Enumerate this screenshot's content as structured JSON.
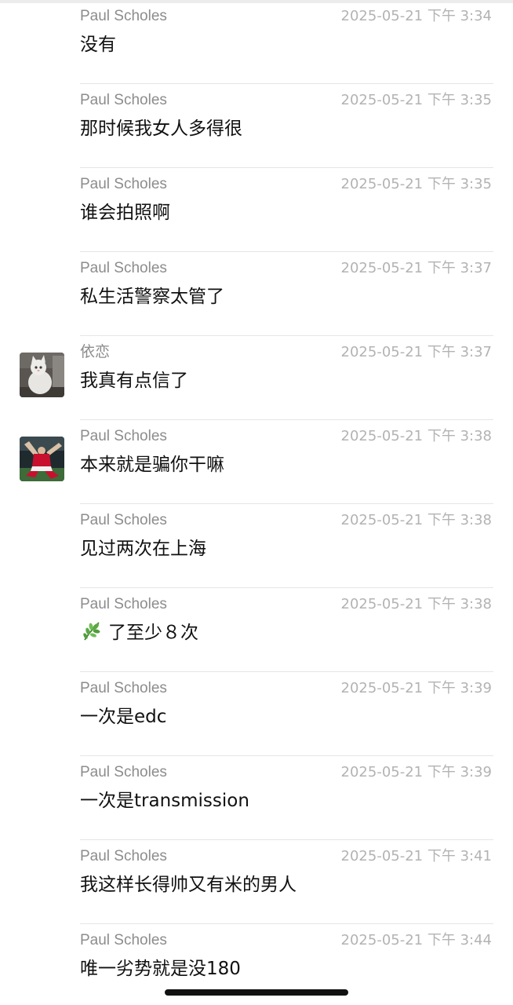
{
  "messages": [
    {
      "sender": "Paul Scholes",
      "time": "2025-05-21 下午 3:34",
      "text": "没有",
      "avatar": null
    },
    {
      "sender": "Paul Scholes",
      "time": "2025-05-21 下午 3:35",
      "text": "那时候我女人多得很",
      "avatar": null
    },
    {
      "sender": "Paul Scholes",
      "time": "2025-05-21 下午 3:35",
      "text": "谁会拍照啊",
      "avatar": null
    },
    {
      "sender": "Paul Scholes",
      "time": "2025-05-21 下午 3:37",
      "text": "私生活警察太管了",
      "avatar": null
    },
    {
      "sender": "依恋",
      "time": "2025-05-21 下午 3:37",
      "text": "我真有点信了",
      "avatar": "cat-avatar"
    },
    {
      "sender": "Paul Scholes",
      "time": "2025-05-21 下午 3:38",
      "text": "本来就是骗你干嘛",
      "avatar": "football-player-avatar"
    },
    {
      "sender": "Paul Scholes",
      "time": "2025-05-21 下午 3:38",
      "text": "见过两次在上海",
      "avatar": null
    },
    {
      "sender": "Paul Scholes",
      "time": "2025-05-21 下午 3:38",
      "text": "了至少８次",
      "avatar": null,
      "leading_icon": "herb-leaf-icon"
    },
    {
      "sender": "Paul Scholes",
      "time": "2025-05-21 下午 3:39",
      "text": "一次是edc",
      "avatar": null
    },
    {
      "sender": "Paul Scholes",
      "time": "2025-05-21 下午 3:39",
      "text": "一次是transmission",
      "avatar": null
    },
    {
      "sender": "Paul Scholes",
      "time": "2025-05-21 下午 3:41",
      "text": "我这样长得帅又有米的男人",
      "avatar": null
    },
    {
      "sender": "Paul Scholes",
      "time": "2025-05-21 下午 3:44",
      "text": "唯一劣势就是没180",
      "avatar": null
    }
  ],
  "colors": {
    "sender": "#8c8c8c",
    "time": "#b3b3b3",
    "text": "#111111",
    "separator": "#e5e5e5",
    "leaf_green": "#4f9d3a"
  }
}
